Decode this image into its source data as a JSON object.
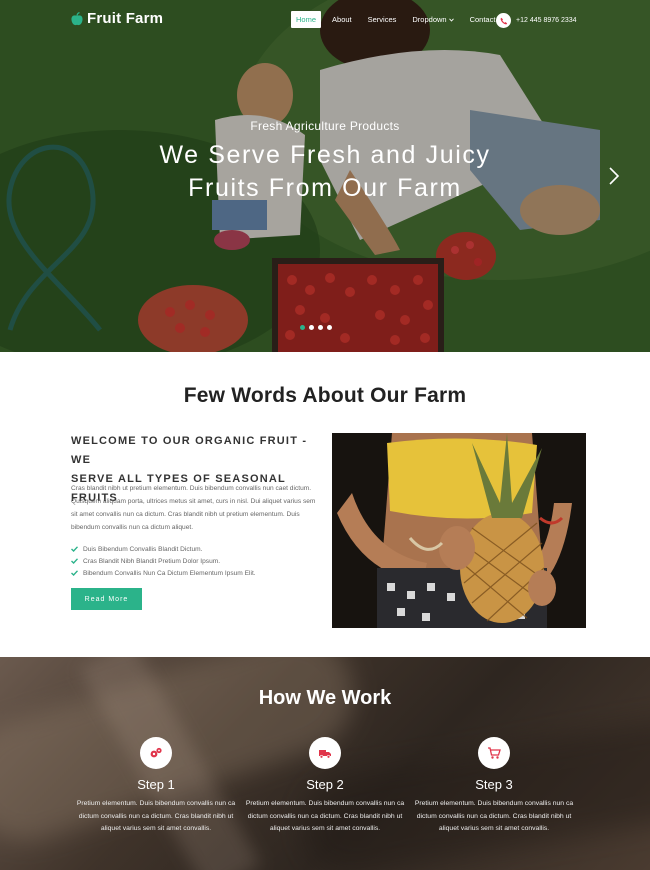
{
  "nav": {
    "brand": "Fruit Farm",
    "items": [
      {
        "label": "Home",
        "active": true
      },
      {
        "label": "About",
        "active": false
      },
      {
        "label": "Services",
        "active": false
      },
      {
        "label": "Dropdown",
        "active": false,
        "has_caret": true
      },
      {
        "label": "Contact",
        "active": false
      }
    ],
    "phone": "+12 445 8976 2334"
  },
  "hero": {
    "subtitle": "Fresh Agriculture Products",
    "title_line1": "We Serve Fresh and Juicy",
    "title_line2": "Fruits From Our Farm",
    "slides": 4,
    "active_slide": 1
  },
  "about": {
    "title": "Few Words About Our Farm",
    "heading_line1": "WELCOME TO OUR ORGANIC FRUIT - WE",
    "heading_line2": "SERVE ALL TYPES OF SEASONAL FRUITS",
    "paragraph": "Cras blandit nibh ut pretium elementum. Duis bibendum convallis nun caet dictum. Quisquem aliquam porta, ultrices metus sit amet, curs in nisl. Dui aliquet varius sem sit amet convallis nun ca dictum. Cras blandit nibh ut pretium elementum. Duis bibendum convallis nun ca dictum aliquet.",
    "checklist": [
      "Duis Bibendum Convallis Blandit Dictum.",
      "Cras Blandit Nibh Blandit Pretium Dolor Ipsum.",
      "Bibendum Convallis Nun Ca Dictum Elementum Ipsum Elit."
    ],
    "button": "Read More"
  },
  "work": {
    "title": "How We Work",
    "steps": [
      {
        "title": "Step 1",
        "text": "Pretium elementum. Duis bibendum convallis nun ca dictum convallis nun ca dictum. Cras blandit nibh ut aliquet varius sem sit amet convallis.",
        "icon": "gears-icon"
      },
      {
        "title": "Step 2",
        "text": "Pretium elementum. Duis bibendum convallis nun ca dictum convallis nun ca dictum. Cras blandit nibh ut aliquet varius sem sit amet convallis.",
        "icon": "truck-icon"
      },
      {
        "title": "Step 3",
        "text": "Pretium elementum. Duis bibendum convallis nun ca dictum convallis nun ca dictum. Cras blandit nibh ut aliquet varius sem sit amet convallis.",
        "icon": "cart-icon"
      }
    ]
  },
  "colors": {
    "accent": "#2bb38a",
    "icon_red": "#e0344a"
  }
}
